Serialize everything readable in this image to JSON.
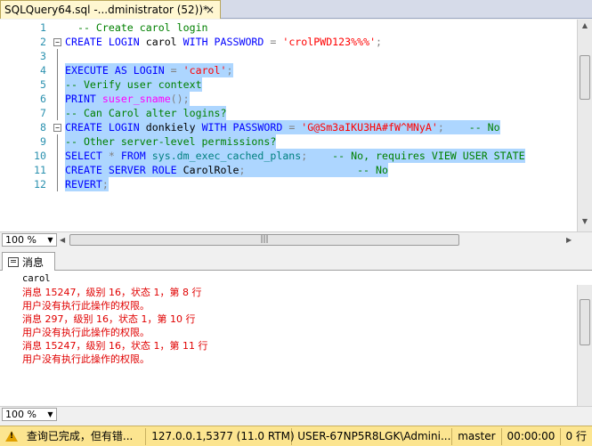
{
  "tab": {
    "title": "SQLQuery64.sql -...dministrator (52))*",
    "close": "×"
  },
  "editor": {
    "lines": [
      {
        "n": "1",
        "hl": false,
        "fold": "",
        "tokens": [
          {
            "c": "cm",
            "t": "  -- Create carol login"
          }
        ]
      },
      {
        "n": "2",
        "hl": false,
        "fold": "−",
        "tokens": [
          {
            "c": "kw",
            "t": "CREATE LOGIN "
          },
          {
            "c": "tx",
            "t": "carol "
          },
          {
            "c": "kw",
            "t": "WITH PASSWORD "
          },
          {
            "c": "op",
            "t": "= "
          },
          {
            "c": "st",
            "t": "'crolPWD123%%%'"
          },
          {
            "c": "op",
            "t": ";"
          }
        ]
      },
      {
        "n": "3",
        "hl": false,
        "fold": "",
        "tokens": []
      },
      {
        "n": "4",
        "hl": true,
        "fold": "",
        "tokens": [
          {
            "c": "kw",
            "t": "EXECUTE AS LOGIN "
          },
          {
            "c": "op",
            "t": "= "
          },
          {
            "c": "st",
            "t": "'carol'"
          },
          {
            "c": "op",
            "t": ";"
          }
        ]
      },
      {
        "n": "5",
        "hl": true,
        "fold": "",
        "tokens": [
          {
            "c": "cm",
            "t": "-- Verify user context"
          }
        ]
      },
      {
        "n": "6",
        "hl": true,
        "fold": "",
        "tokens": [
          {
            "c": "kw",
            "t": "PRINT "
          },
          {
            "c": "fn",
            "t": "suser_sname"
          },
          {
            "c": "op",
            "t": "();"
          }
        ]
      },
      {
        "n": "7",
        "hl": true,
        "fold": "",
        "tokens": [
          {
            "c": "cm",
            "t": "-- Can Carol alter logins?"
          }
        ]
      },
      {
        "n": "8",
        "hl": true,
        "fold": "−",
        "tokens": [
          {
            "c": "kw",
            "t": "CREATE LOGIN "
          },
          {
            "c": "tx",
            "t": "donkiely "
          },
          {
            "c": "kw",
            "t": "WITH PASSWORD "
          },
          {
            "c": "op",
            "t": "= "
          },
          {
            "c": "st",
            "t": "'G@Sm3aIKU3HA#fW^MNyA'"
          },
          {
            "c": "op",
            "t": ";   "
          },
          {
            "c": "cm",
            "t": " -- No"
          }
        ]
      },
      {
        "n": "9",
        "hl": true,
        "fold": "",
        "tokens": [
          {
            "c": "cm",
            "t": "-- Other server-level permissions?"
          }
        ]
      },
      {
        "n": "10",
        "hl": true,
        "fold": "",
        "tokens": [
          {
            "c": "kw",
            "t": "SELECT "
          },
          {
            "c": "op",
            "t": "* "
          },
          {
            "c": "kw",
            "t": "FROM "
          },
          {
            "c": "sf",
            "t": "sys.dm_exec_cached_plans"
          },
          {
            "c": "op",
            "t": ";   "
          },
          {
            "c": "cm",
            "t": " -- No, requires VIEW USER STATE"
          }
        ]
      },
      {
        "n": "11",
        "hl": true,
        "fold": "",
        "tokens": [
          {
            "c": "kw",
            "t": "CREATE SERVER ROLE "
          },
          {
            "c": "tx",
            "t": "CarolRole"
          },
          {
            "c": "op",
            "t": ";"
          },
          {
            "c": "cm",
            "t": "                  -- No"
          }
        ]
      },
      {
        "n": "12",
        "hl": true,
        "fold": "",
        "tokens": [
          {
            "c": "kw",
            "t": "REVERT"
          },
          {
            "c": "op",
            "t": ";"
          }
        ]
      }
    ]
  },
  "zoom": {
    "value": "100 %"
  },
  "messages_tab": {
    "label": "消息"
  },
  "messages": [
    {
      "cls": "black",
      "text": "carol"
    },
    {
      "cls": "red",
      "text": "消息 15247，级别 16，状态 1，第 8 行"
    },
    {
      "cls": "red",
      "text": "用户没有执行此操作的权限。"
    },
    {
      "cls": "red",
      "text": "消息 297，级别 16，状态 1，第 10 行"
    },
    {
      "cls": "red",
      "text": "用户没有执行此操作的权限。"
    },
    {
      "cls": "red",
      "text": "消息 15247，级别 16，状态 1，第 11 行"
    },
    {
      "cls": "red",
      "text": "用户没有执行此操作的权限。"
    }
  ],
  "zoom2": {
    "value": "100 %"
  },
  "status": {
    "message": "查询已完成，但有错...",
    "server": "127.0.0.1,5377 (11.0 RTM)",
    "user": "USER-67NP5R8LGK\\Admini...",
    "database": "master",
    "elapsed": "00:00:00",
    "rows": "0 行"
  }
}
